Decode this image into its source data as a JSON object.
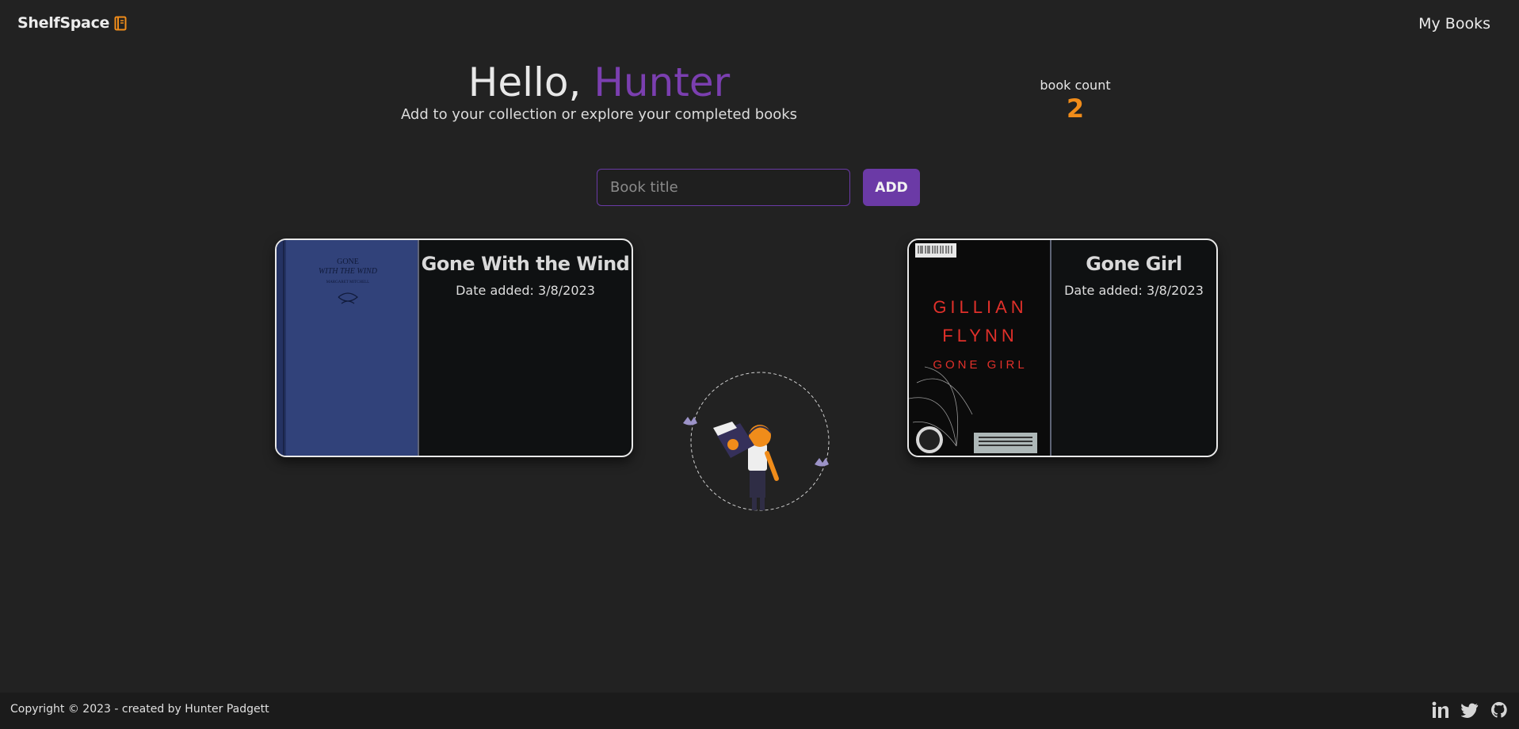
{
  "header": {
    "brand": "ShelfSpace",
    "brand_icon": "book-icon",
    "nav_link": "My Books"
  },
  "greeting": {
    "hello": "Hello,",
    "name": "Hunter",
    "subtitle": "Add to your collection or explore your completed books"
  },
  "stats": {
    "label": "book count",
    "value": "2"
  },
  "add_form": {
    "placeholder": "Book title",
    "button": "ADD"
  },
  "books": [
    {
      "title": "Gone With the Wind",
      "date_added": "Date added: 3/8/2023",
      "cover_text": [
        "GONE",
        "WITH THE WIND",
        "MARGARET MITCHELL"
      ]
    },
    {
      "title": "Gone Girl",
      "date_added": "Date added: 3/8/2023",
      "cover_text": [
        "GILLIAN",
        "FLYNN",
        "GONE GIRL"
      ]
    }
  ],
  "footer": {
    "copyright": "Copyright © 2023 - created by Hunter Padgett",
    "social": [
      "linkedin-icon",
      "twitter-icon",
      "github-icon"
    ]
  },
  "colors": {
    "background": "#222222",
    "accent_purple": "#6b3aa6",
    "accent_orange": "#f08c1a"
  }
}
